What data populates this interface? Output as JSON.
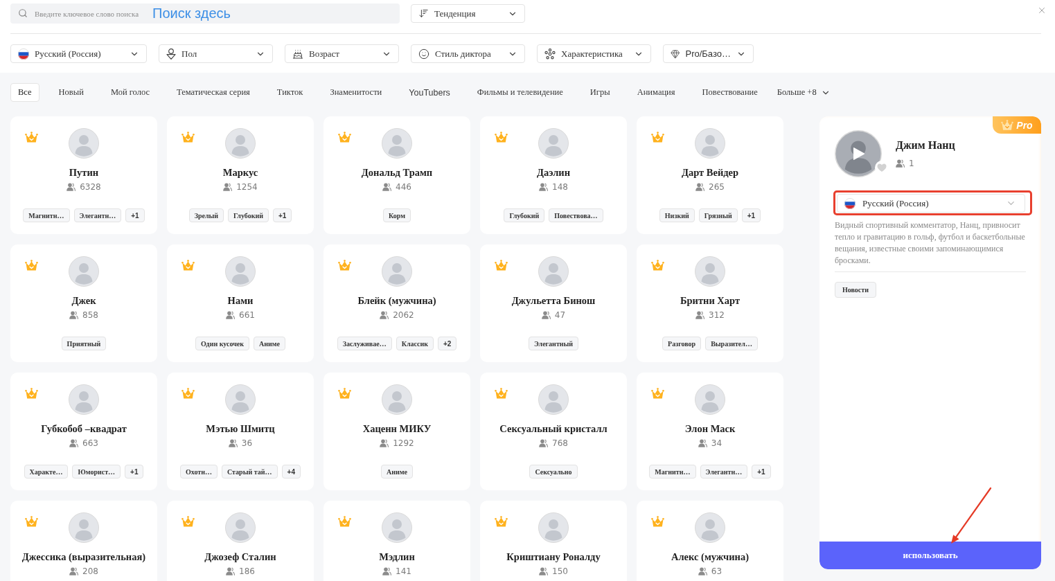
{
  "search": {
    "placeholder": "Введите ключевое слово поиска",
    "annotation": "Поиск здесь"
  },
  "sort": {
    "label": "Тенденция"
  },
  "filters": [
    {
      "kind": "language",
      "label": "Русский (Россия)"
    },
    {
      "kind": "gender",
      "label": "Пол"
    },
    {
      "kind": "age",
      "label": "Возраст"
    },
    {
      "kind": "style",
      "label": "Стиль диктора"
    },
    {
      "kind": "trait",
      "label": "Характеристика"
    },
    {
      "kind": "tier",
      "label": "Pro/Базо…"
    }
  ],
  "categories": [
    {
      "label": "Все",
      "selected": true
    },
    {
      "label": "Новый",
      "selected": false
    },
    {
      "label": "Мой голос",
      "selected": false
    },
    {
      "label": "Тематическая серия",
      "selected": false
    },
    {
      "label": "Тикток",
      "selected": false
    },
    {
      "label": "Знаменитости",
      "selected": false
    },
    {
      "label": "YouTubers",
      "selected": false
    },
    {
      "label": "Фильмы и телевидение",
      "selected": false
    },
    {
      "label": "Игры",
      "selected": false
    },
    {
      "label": "Анимация",
      "selected": false
    },
    {
      "label": "Повествование",
      "selected": false
    }
  ],
  "more_categories": {
    "label": "Больше +8"
  },
  "voices": [
    {
      "name": "Путин",
      "pro": true,
      "users": "6328",
      "tags": [
        "Магнитн…",
        "Элегантн…"
      ],
      "extra": "+1"
    },
    {
      "name": "Маркус",
      "pro": true,
      "users": "1254",
      "tags": [
        "Зрелый",
        "Глубокий"
      ],
      "extra": "+1"
    },
    {
      "name": "Дональд Трамп",
      "pro": true,
      "users": "446",
      "tags": [
        "Корм"
      ]
    },
    {
      "name": "Даэлин",
      "pro": true,
      "users": "148",
      "tags": [
        "Глубокий",
        "Повествова…"
      ]
    },
    {
      "name": "Дарт Вейдер",
      "pro": true,
      "users": "265",
      "tags": [
        "Низкий",
        "Грязный"
      ],
      "extra": "+1"
    },
    {
      "name": "Джек",
      "pro": true,
      "users": "858",
      "tags": [
        "Приятный"
      ]
    },
    {
      "name": "Нами",
      "pro": true,
      "users": "661",
      "tags": [
        "Один кусочек",
        "Аниме"
      ]
    },
    {
      "name": "Блейк (мужчина)",
      "pro": true,
      "users": "2062",
      "tags": [
        "Заслуживае…",
        "Классик"
      ],
      "extra": "+2"
    },
    {
      "name": "Джульетта Бинош",
      "pro": true,
      "users": "47",
      "tags": [
        "Элегантный"
      ]
    },
    {
      "name": "Бритни Харт",
      "pro": true,
      "users": "312",
      "tags": [
        "Разговор",
        "Выразител…"
      ]
    },
    {
      "name": "Губкобоб –квадрат",
      "pro": true,
      "users": "663",
      "tags": [
        "Характе…",
        "Юморист…"
      ],
      "extra": "+1"
    },
    {
      "name": "Мэтью Шмитц",
      "pro": true,
      "users": "36",
      "tags": [
        "Охотн…",
        "Старый тай…"
      ],
      "extra": "+4"
    },
    {
      "name": "Хаценн МИКУ",
      "pro": true,
      "users": "1292",
      "tags": [
        "Аниме"
      ]
    },
    {
      "name": "Сексуальный кристалл",
      "pro": true,
      "users": "768",
      "tags": [
        "Сексуально"
      ]
    },
    {
      "name": "Элон Маск",
      "pro": true,
      "users": "34",
      "tags": [
        "Магнитн…",
        "Элегантн…"
      ],
      "extra": "+1"
    },
    {
      "name": "Джессика (выразительная)",
      "pro": true,
      "users": "208"
    },
    {
      "name": "Джозеф Сталин",
      "pro": true,
      "users": "186"
    },
    {
      "name": "Мэдлин",
      "pro": true,
      "users": "141"
    },
    {
      "name": "Криштиану Роналду",
      "pro": true,
      "users": "150"
    },
    {
      "name": "Алекс (мужчина)",
      "pro": true,
      "users": "63"
    }
  ],
  "details": {
    "badge": "Pro",
    "name": "Джим Нанц",
    "users": "1",
    "favorite": false,
    "language": "Русский (Россия)",
    "description": "Видный спортивный комментатор, Нанц, привносит тепло и гравитацию в гольф, футбол и баскетбольные вещания, известные своими запоминающимися бросками.",
    "tags": [
      "Новости"
    ],
    "action": "использовать"
  }
}
